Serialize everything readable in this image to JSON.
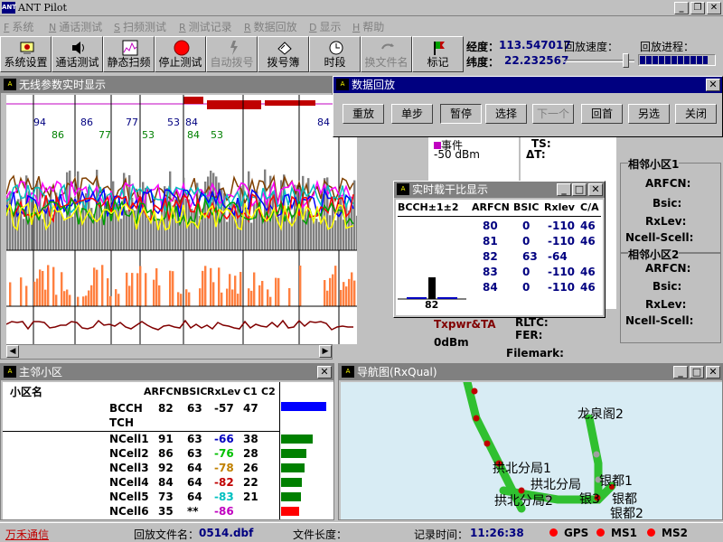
{
  "app": {
    "title": "ANT Pilot",
    "icon": "antenna-app-icon"
  },
  "menu": [
    {
      "key": "F",
      "label": "系统"
    },
    {
      "key": "N",
      "label": "通话测试"
    },
    {
      "key": "S",
      "label": "扫频测试"
    },
    {
      "key": "R",
      "label": "测试记录"
    },
    {
      "key": "R",
      "label": "数据回放"
    },
    {
      "key": "D",
      "label": "显示"
    },
    {
      "key": "H",
      "label": "帮助"
    }
  ],
  "toolbar": [
    {
      "label": "系统设置",
      "icon": "system-settings-icon",
      "enabled": true
    },
    {
      "label": "通话测试",
      "icon": "speaker-icon",
      "enabled": true
    },
    {
      "label": "静态扫频",
      "icon": "spectrum-icon",
      "enabled": true
    },
    {
      "label": "停止测试",
      "icon": "stop-icon",
      "enabled": true
    },
    {
      "label": "自动拨号",
      "icon": "auto-dial-icon",
      "enabled": false
    },
    {
      "label": "拨号簿",
      "icon": "phonebook-icon",
      "enabled": true
    },
    {
      "label": "时段",
      "icon": "clock-icon",
      "enabled": true
    },
    {
      "label": "换文件名",
      "icon": "rename-file-icon",
      "enabled": false
    },
    {
      "label": "标记",
      "icon": "mark-flag-icon",
      "enabled": true
    }
  ],
  "info": {
    "longitude_label": "经度：",
    "longitude": "113.547017",
    "latitude_label": "纬度：",
    "latitude": "22.232567",
    "speed_label": "回放速度：",
    "speed_fraction": 0.93,
    "progress_label": "回放进程：",
    "progress_fraction": 0.92
  },
  "realtime_window": {
    "title": "无线参数实时显示",
    "markers_top": [
      "94",
      "86",
      "77",
      "53",
      "84",
      "84"
    ],
    "markers_green": [
      "86",
      "77",
      "53",
      "84",
      "53"
    ],
    "colors": {
      "red": "#c00000",
      "orange": "#ff8040",
      "brown": "#800000",
      "grey": "#808080"
    }
  },
  "params_panel": {
    "event_label": "事件",
    "level": "-50 dBm",
    "ts_label": "TS:",
    "dt_label": "ΔT:",
    "txpwr_label": "Txpwr&TA",
    "txpwr_value": "0dBm",
    "rltc_label": "RLTC:",
    "fer_label": "FER:",
    "filemark_label": "Filemark:",
    "neighbor1_title": "相邻小区1",
    "neighbor2_title": "相邻小区2",
    "fields": [
      "ARFCN:",
      "Bsic:",
      "RxLev:",
      "Ncell-Scell:"
    ]
  },
  "playback_window": {
    "title": "数据回放",
    "buttons": [
      {
        "label": "重放",
        "enabled": true
      },
      {
        "label": "单步",
        "enabled": true
      },
      {
        "label": "暂停",
        "enabled": true,
        "pressed": true
      },
      {
        "label": "选择",
        "enabled": true
      },
      {
        "label": "下一个",
        "enabled": false
      },
      {
        "label": "回首",
        "enabled": true
      },
      {
        "label": "另选",
        "enabled": true
      },
      {
        "label": "关闭",
        "enabled": true
      }
    ]
  },
  "ci_window": {
    "title": "实时载干比显示",
    "headers": [
      "BCCH±1±2",
      "ARFCN",
      "BSIC",
      "Rxlev",
      "C/A"
    ],
    "rows": [
      {
        "arfcn": "80",
        "bsic": "0",
        "rxlev": "-110",
        "ca": "46"
      },
      {
        "arfcn": "81",
        "bsic": "0",
        "rxlev": "-110",
        "ca": "46"
      },
      {
        "arfcn": "82",
        "bsic": "63",
        "rxlev": "-64",
        "ca": ""
      },
      {
        "arfcn": "83",
        "bsic": "0",
        "rxlev": "-110",
        "ca": "46"
      },
      {
        "arfcn": "84",
        "bsic": "0",
        "rxlev": "-110",
        "ca": "46"
      }
    ],
    "bar_label": "82"
  },
  "cell_window": {
    "title": "主邻小区",
    "headers": {
      "name": "小区名",
      "arfcn": "ARFCN",
      "bsic": "BSIC",
      "rxlev": "RxLev",
      "c1": "C1",
      "c2": "C2"
    },
    "serving": {
      "name": "BCCH",
      "arfcn": "82",
      "bsic": "63",
      "rxlev": "-57",
      "c1": "47",
      "c2": ""
    },
    "tch_label": "TCH",
    "ncells": [
      {
        "name": "NCell1",
        "arfcn": "91",
        "bsic": "63",
        "rxlev": "-66",
        "rxlev_color": "#0000c0",
        "c1": "38",
        "bar_color": "#008000",
        "bar_fraction": 0.7
      },
      {
        "name": "NCell2",
        "arfcn": "86",
        "bsic": "63",
        "rxlev": "-76",
        "rxlev_color": "#00c000",
        "c1": "28",
        "bar_color": "#008000",
        "bar_fraction": 0.55
      },
      {
        "name": "NCell3",
        "arfcn": "92",
        "bsic": "64",
        "rxlev": "-78",
        "rxlev_color": "#c08000",
        "c1": "26",
        "bar_color": "#008000",
        "bar_fraction": 0.52
      },
      {
        "name": "NCell4",
        "arfcn": "84",
        "bsic": "64",
        "rxlev": "-82",
        "rxlev_color": "#c00000",
        "c1": "22",
        "bar_color": "#008000",
        "bar_fraction": 0.45
      },
      {
        "name": "NCell5",
        "arfcn": "73",
        "bsic": "64",
        "rxlev": "-83",
        "rxlev_color": "#00c0c0",
        "c1": "21",
        "bar_color": "#008000",
        "bar_fraction": 0.44
      },
      {
        "name": "NCell6",
        "arfcn": "35",
        "bsic": "**",
        "rxlev": "-86",
        "rxlev_color": "#c000c0",
        "c1": "",
        "bar_color": "#ff0000",
        "bar_fraction": 0.4
      }
    ],
    "serving_bar_color": "#0000ff",
    "serving_bar_fraction": 1.0
  },
  "map_window": {
    "title": "导航图(RxQual)",
    "labels": [
      "龙泉阁2",
      "拱北分局1",
      "拱北分局",
      "银都1",
      "银都",
      "银都2",
      "银3",
      "拱北分局2"
    ]
  },
  "status": {
    "company": "万禾通信",
    "file_label": "回放文件名：",
    "file": "0514.dbf",
    "len_label": "文件长度：",
    "time_label": "记录时间：",
    "time": "11:26:38",
    "indicators": [
      "GPS",
      "MS1",
      "MS2"
    ],
    "indicator_color": "#ff0000"
  }
}
